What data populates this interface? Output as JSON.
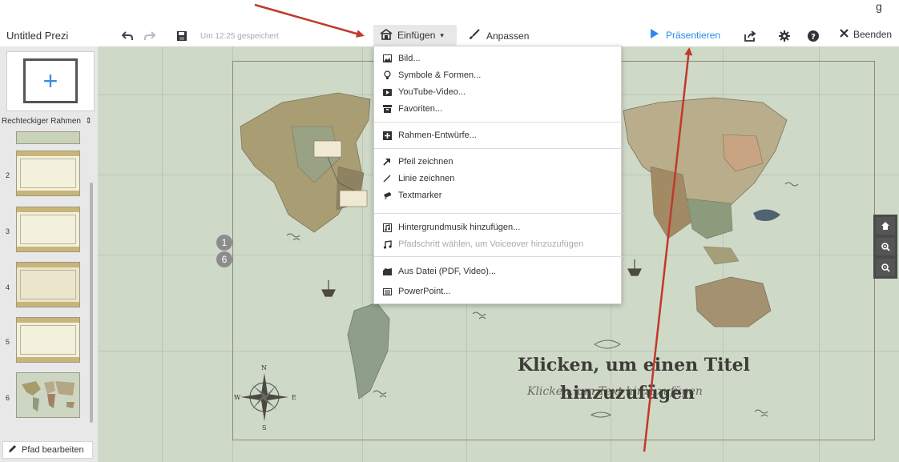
{
  "colors": {
    "accent_blue": "#2c8be8",
    "annotation_red": "#c0392b",
    "map_background": "#cfd9c8",
    "sidebar_gray": "#e8e8e8",
    "menu_disabled": "#a9a9a9"
  },
  "header_note": "g",
  "toolbar": {
    "title": "Untitled Prezi",
    "undo_icon": "undo-icon",
    "redo_icon": "redo-icon",
    "save_icon": "save-icon",
    "saved_status": "Um 12:25 gespeichert",
    "insert_label": "Einfügen",
    "customize_label": "Anpassen",
    "present_label": "Präsentieren",
    "share_icon": "share-icon",
    "settings_icon": "gear-icon",
    "help_icon": "help-icon",
    "exit_label": "Beenden"
  },
  "sidebar": {
    "frame_type": "Rechteckiger Rahmen",
    "thumbnails": [
      {
        "number": "2"
      },
      {
        "number": "3"
      },
      {
        "number": "4"
      },
      {
        "number": "5"
      },
      {
        "number": "6"
      }
    ],
    "edit_path_label": "Pfad bearbeiten"
  },
  "canvas": {
    "path_badges": [
      "1",
      "6"
    ],
    "slide_title_line1": "Klicken, um einen Titel",
    "slide_title_line2": "hinzuzufügen",
    "slide_subtitle": "Klicken, um Text hinzuzufügen",
    "compass_labels": {
      "n": "N",
      "s": "S",
      "e": "E",
      "w": "W"
    }
  },
  "insert_menu": {
    "groups": [
      [
        {
          "label": "Bild...",
          "icon": "image-icon"
        },
        {
          "label": "Symbole & Formen...",
          "icon": "lightbulb-icon"
        },
        {
          "label": "YouTube-Video...",
          "icon": "youtube-icon"
        },
        {
          "label": "Favoriten...",
          "icon": "archive-icon"
        }
      ],
      [
        {
          "label": "Rahmen-Entwürfe...",
          "icon": "frame-layout-icon"
        }
      ],
      [
        {
          "label": "Pfeil zeichnen",
          "icon": "arrow-icon"
        },
        {
          "label": "Linie zeichnen",
          "icon": "line-icon"
        },
        {
          "label": "Textmarker",
          "icon": "marker-icon"
        }
      ],
      [
        {
          "label": "Hintergrundmusik hinzufügen...",
          "icon": "music-file-icon"
        },
        {
          "label": "Pfadschritt wählen, um Voiceover hinzuzufügen",
          "icon": "music-note-icon",
          "disabled": true
        }
      ],
      [
        {
          "label": "Aus Datei (PDF, Video)...",
          "icon": "file-stack-icon"
        },
        {
          "label": "PowerPoint...",
          "icon": "powerpoint-icon"
        }
      ]
    ]
  },
  "zoom_controls": [
    "home-icon",
    "zoom-in-icon",
    "zoom-out-icon"
  ]
}
